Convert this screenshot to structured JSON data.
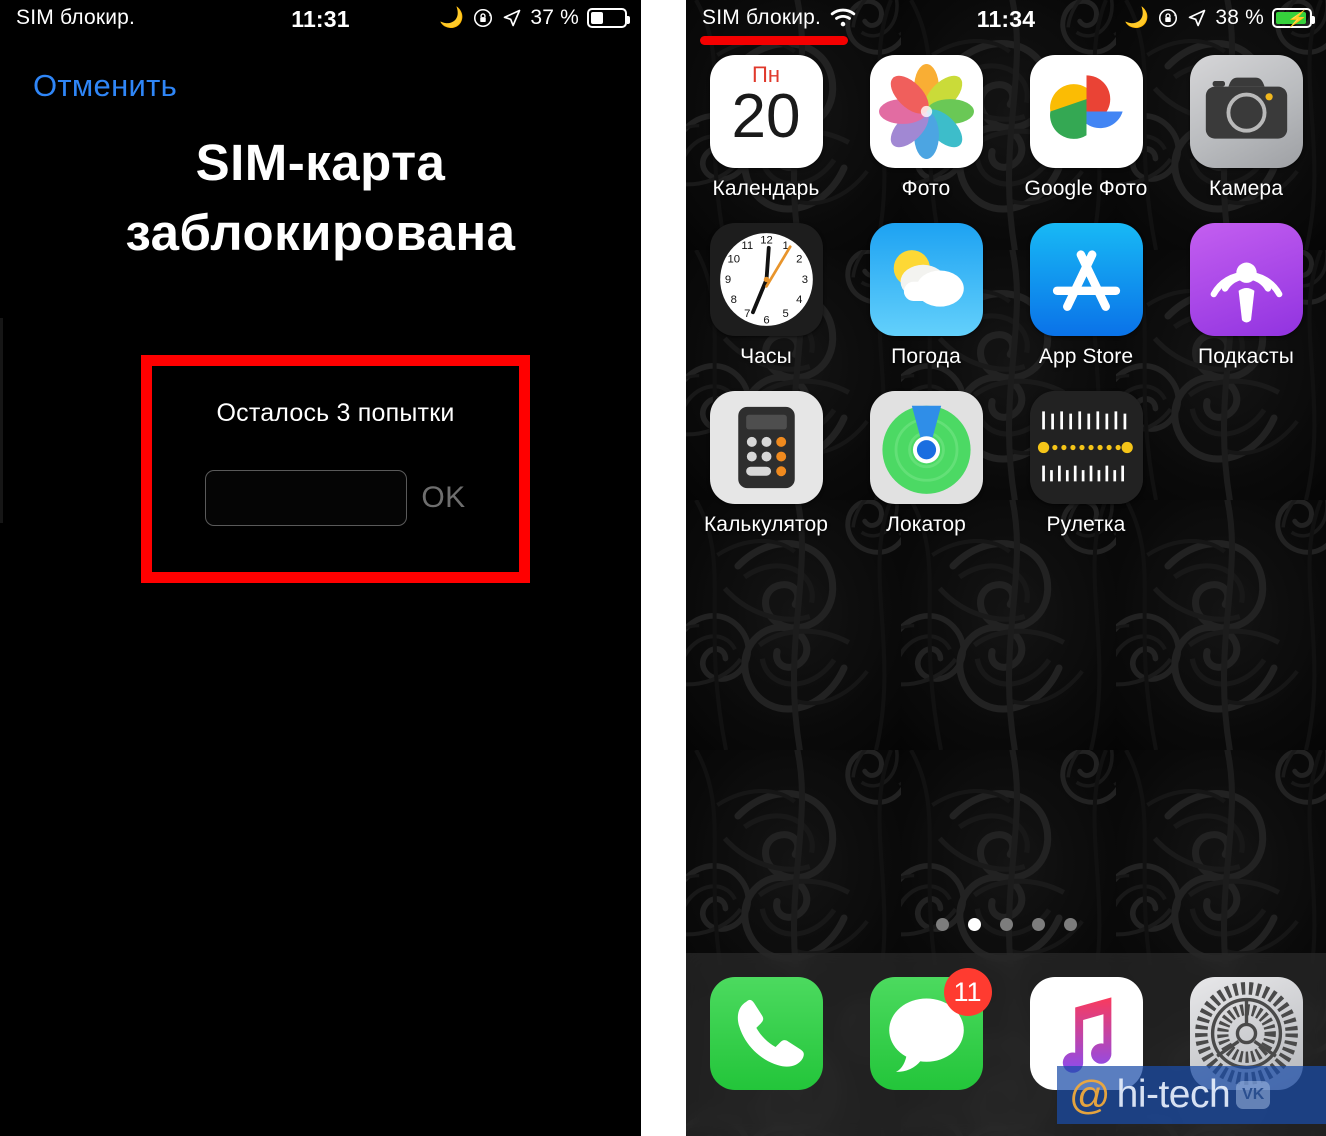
{
  "left_screen": {
    "status_bar": {
      "carrier": "SIM блокир.",
      "time": "11:31",
      "battery_percent": "37 %",
      "moon_icon": "moon-icon",
      "rotation_lock_icon": "rotation-lock-icon",
      "location_icon": "location-arrow-icon",
      "battery_icon": "battery-icon"
    },
    "cancel_label": "Отменить",
    "title_line1": "SIM-карта",
    "title_line2": "заблокирована",
    "dialog": {
      "attempts_text": "Осталось 3 попытки",
      "pin_value": "",
      "pin_placeholder": "",
      "ok_label": "OK",
      "highlight_color": "#ff0000"
    },
    "accent_color": "#2f86f7"
  },
  "right_screen": {
    "status_bar": {
      "carrier": "SIM блокир.",
      "wifi_icon": "wifi-icon",
      "time": "11:34",
      "battery_percent": "38 %",
      "moon_icon": "moon-icon",
      "rotation_lock_icon": "rotation-lock-icon",
      "location_icon": "location-arrow-icon",
      "battery_icon": "battery-charging-icon",
      "underline_color": "#f40000"
    },
    "apps": [
      {
        "label": "Календарь",
        "icon": "calendar-icon",
        "day_of_week": "Пн",
        "day": "20"
      },
      {
        "label": "Фото",
        "icon": "photos-icon"
      },
      {
        "label": "Google Фото",
        "icon": "google-photos-icon"
      },
      {
        "label": "Камера",
        "icon": "camera-icon"
      },
      {
        "label": "Часы",
        "icon": "clock-icon"
      },
      {
        "label": "Погода",
        "icon": "weather-icon"
      },
      {
        "label": "App Store",
        "icon": "app-store-icon"
      },
      {
        "label": "Подкасты",
        "icon": "podcasts-icon"
      },
      {
        "label": "Калькулятор",
        "icon": "calculator-icon"
      },
      {
        "label": "Локатор",
        "icon": "find-my-icon"
      },
      {
        "label": "Рулетка",
        "icon": "measure-icon"
      },
      {
        "label": "",
        "icon": ""
      }
    ],
    "page_dots": {
      "count": 5,
      "active_index": 1
    },
    "dock": [
      {
        "label": "Телефон",
        "icon": "phone-icon",
        "badge": ""
      },
      {
        "label": "Сообщения",
        "icon": "messages-icon",
        "badge": "11"
      },
      {
        "label": "Музыка",
        "icon": "music-icon",
        "badge": ""
      },
      {
        "label": "Настройки",
        "icon": "settings-gear-icon",
        "badge": ""
      }
    ]
  },
  "watermark": {
    "at": "@",
    "text": "hi-tech",
    "vk": "VK"
  }
}
